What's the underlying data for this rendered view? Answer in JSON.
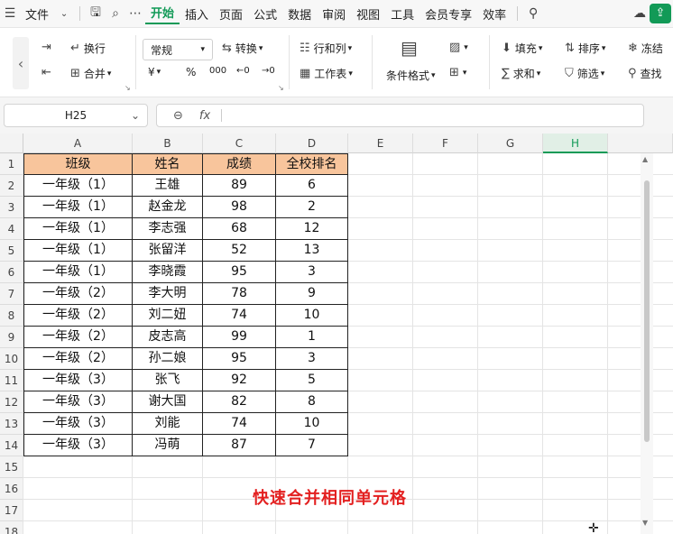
{
  "menu": {
    "app_menu": "文件",
    "tabs": [
      "开始",
      "插入",
      "页面",
      "公式",
      "数据",
      "审阅",
      "视图",
      "工具",
      "会员专享",
      "效率"
    ],
    "active_tab": "开始"
  },
  "ribbon": {
    "wrap": "换行",
    "merge": "合并",
    "format": "常规",
    "convert": "转换",
    "row_col": "行和列",
    "worksheet": "工作表",
    "cond_format": "条件格式",
    "fill": "填充",
    "sort": "排序",
    "freeze": "冻结",
    "sum": "求和",
    "filter": "筛选",
    "find": "查找",
    "currency": "¥",
    "percent": "%",
    "thousands": "000"
  },
  "namebox": {
    "value": "H25"
  },
  "formula": {
    "fx": "fx",
    "value": ""
  },
  "columns": [
    "A",
    "B",
    "C",
    "D",
    "E",
    "F",
    "G",
    "H"
  ],
  "selected_column": "H",
  "rows": [
    "1",
    "2",
    "3",
    "4",
    "5",
    "6",
    "7",
    "8",
    "9",
    "10",
    "11",
    "12",
    "13",
    "14",
    "15",
    "16",
    "17",
    "18"
  ],
  "table": {
    "header": [
      "班级",
      "姓名",
      "成绩",
      "全校排名"
    ],
    "body": [
      [
        "一年级（1）",
        "王雄",
        "89",
        "6"
      ],
      [
        "一年级（1）",
        "赵金龙",
        "98",
        "2"
      ],
      [
        "一年级（1）",
        "李志强",
        "68",
        "12"
      ],
      [
        "一年级（1）",
        "张留洋",
        "52",
        "13"
      ],
      [
        "一年级（1）",
        "李晓霞",
        "95",
        "3"
      ],
      [
        "一年级（2）",
        "李大明",
        "78",
        "9"
      ],
      [
        "一年级（2）",
        "刘二妞",
        "74",
        "10"
      ],
      [
        "一年级（2）",
        "皮志高",
        "99",
        "1"
      ],
      [
        "一年级（2）",
        "孙二娘",
        "95",
        "3"
      ],
      [
        "一年级（3）",
        "张飞",
        "92",
        "5"
      ],
      [
        "一年级（3）",
        "谢大国",
        "82",
        "8"
      ],
      [
        "一年级（3）",
        "刘能",
        "74",
        "10"
      ],
      [
        "一年级（3）",
        "冯萌",
        "87",
        "7"
      ]
    ]
  },
  "overlay_text": "快速合并相同单元格"
}
